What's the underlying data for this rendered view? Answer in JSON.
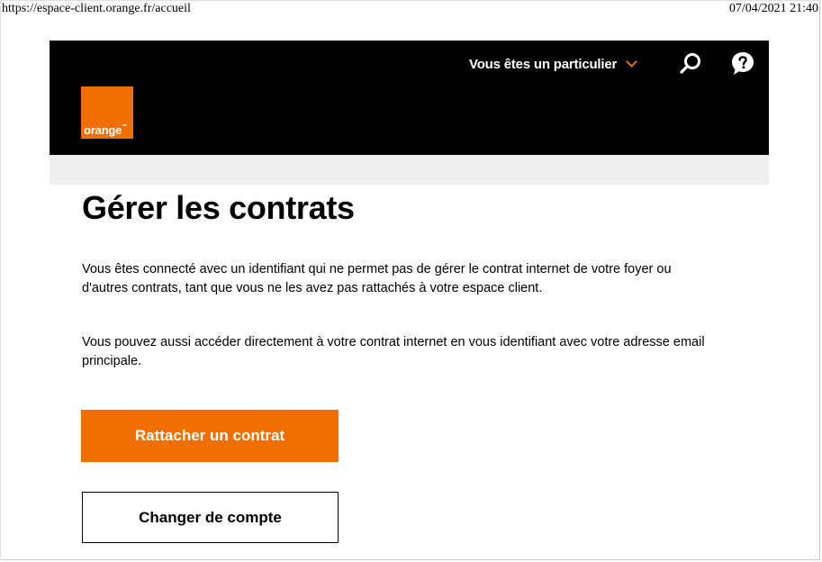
{
  "print": {
    "url": "https://espace-client.orange.fr/accueil",
    "datetime": "07/04/2021 21:40"
  },
  "header": {
    "logo_text": "orange",
    "logo_tm": "™",
    "profile_label": "Vous êtes un particulier",
    "search_icon": "search-icon",
    "help_icon": "help-bubble-icon",
    "chevron_icon": "chevron-down-icon"
  },
  "colors": {
    "brand_orange": "#f16e00",
    "header_black": "#000000",
    "band_gray": "#eeeeee"
  },
  "main": {
    "title": "Gérer les contrats",
    "paragraph1": "Vous êtes connecté avec un identifiant qui ne permet pas de gérer le contrat internet de votre foyer ou d'autres contrats, tant que vous ne les avez pas rattachés à votre espace client.",
    "paragraph2": "Vous pouvez aussi accéder directement à votre contrat internet en vous identifiant avec votre adresse email principale.",
    "primary_button": "Rattacher un contrat",
    "secondary_button": "Changer de compte"
  }
}
